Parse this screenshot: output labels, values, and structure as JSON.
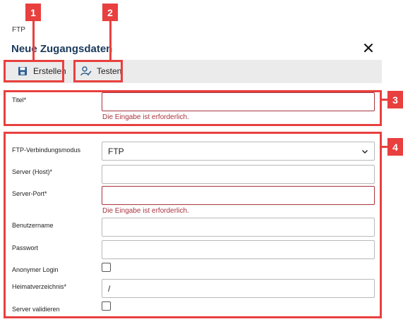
{
  "breadcrumb": "FTP",
  "dialog_title": "Neue Zugangsdaten",
  "close_icon": "close-icon",
  "toolbar": {
    "create_label": "Erstellen",
    "create_icon": "save-icon",
    "test_label": "Testen",
    "test_icon": "user-check-icon"
  },
  "callouts": [
    "1",
    "2",
    "3",
    "4"
  ],
  "form": {
    "title_label": "Titel*",
    "title_value": "",
    "title_error": "Die Eingabe ist erforderlich.",
    "mode_label": "FTP-Verbindungsmodus",
    "mode_value": "FTP",
    "host_label": "Server (Host)*",
    "host_value": "",
    "port_label": "Server-Port*",
    "port_value": "",
    "port_error": "Die Eingabe ist erforderlich.",
    "user_label": "Benutzername",
    "user_value": "",
    "password_label": "Passwort",
    "password_value": "",
    "anon_label": "Anonymer Login",
    "anon_checked": false,
    "home_label": "Heimatverzeichnis*",
    "home_value": "/",
    "validate_label": "Server validieren",
    "validate_checked": false
  },
  "colors": {
    "callout": "#e8403e",
    "error": "#a8343f",
    "title": "#1a3a5c",
    "toolbar_bg": "#ebebeb"
  }
}
